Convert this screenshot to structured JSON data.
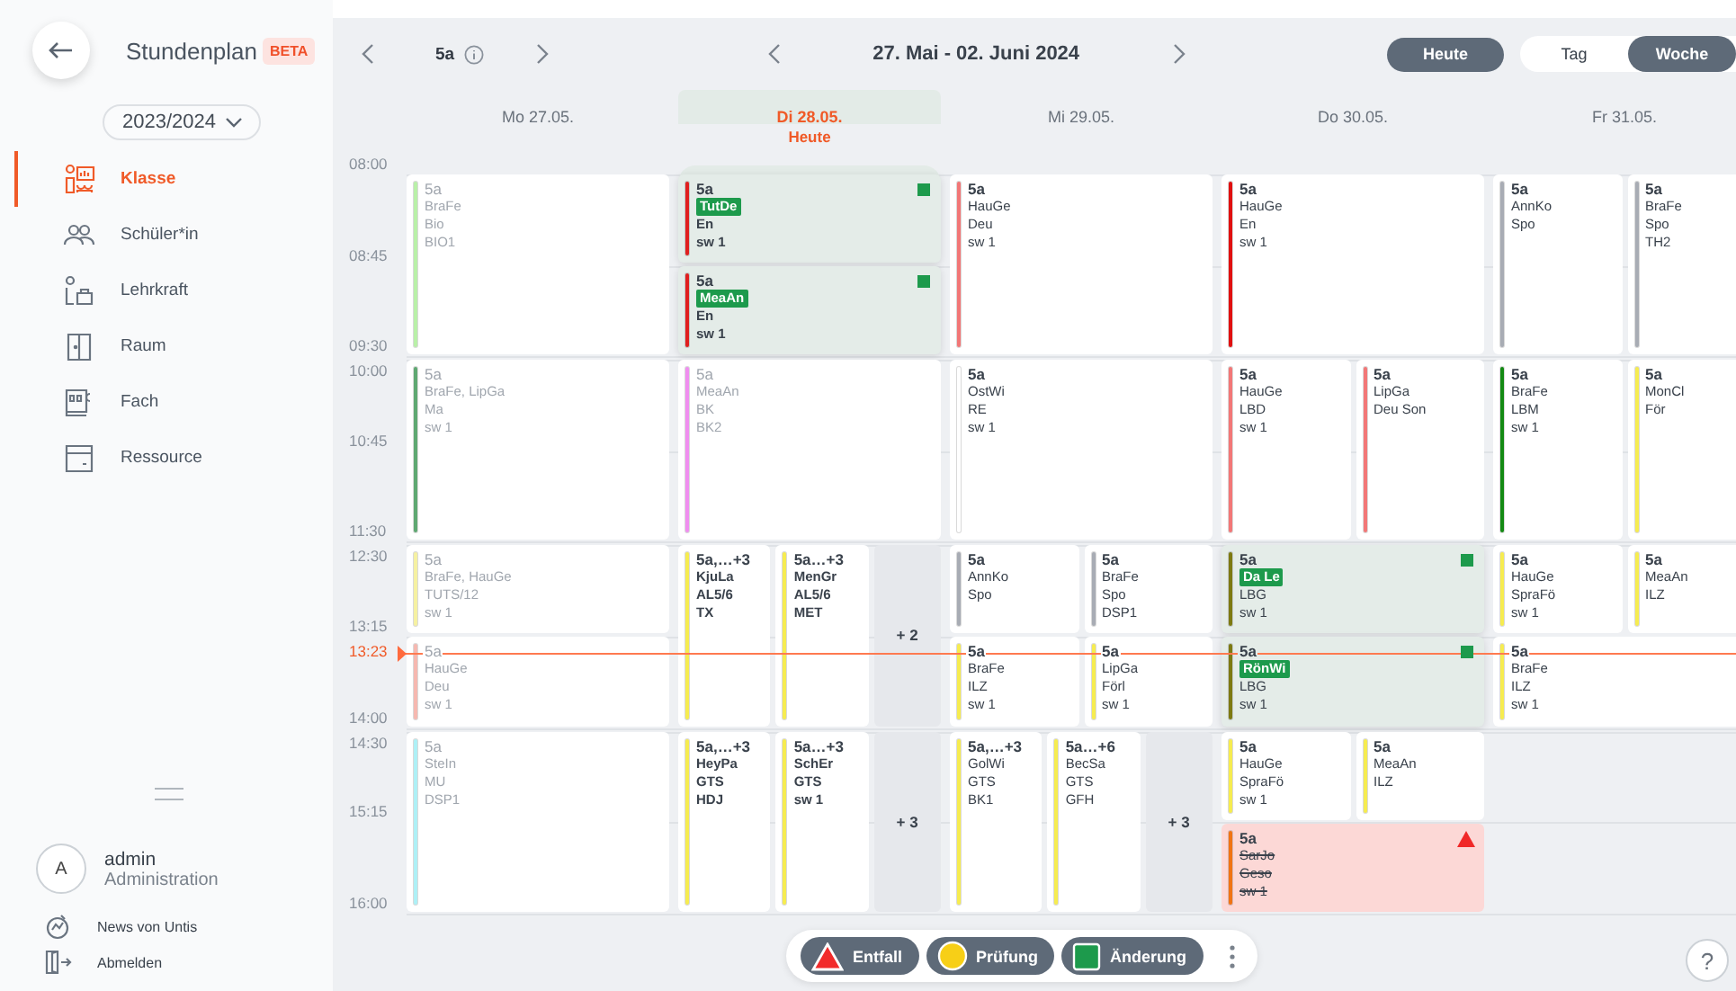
{
  "sidebar": {
    "title": "Stundenplan",
    "badge": "BETA",
    "year": "2023/2024",
    "items": [
      {
        "label": "Klasse",
        "selected": true
      },
      {
        "label": "Schüler*in",
        "selected": false
      },
      {
        "label": "Lehrkraft",
        "selected": false
      },
      {
        "label": "Raum",
        "selected": false
      },
      {
        "label": "Fach",
        "selected": false
      },
      {
        "label": "Ressource",
        "selected": false
      }
    ],
    "user": {
      "avatar": "A",
      "name": "admin",
      "role": "Administration"
    },
    "links": [
      {
        "label": "News von Untis"
      },
      {
        "label": "Abmelden"
      }
    ]
  },
  "toolbar": {
    "class_label": "5a",
    "week_label": "27. Mai - 02. Juni 2024",
    "today_button": "Heute",
    "views": [
      {
        "label": "Tag",
        "selected": false
      },
      {
        "label": "Woche",
        "selected": true
      }
    ]
  },
  "time_axis": [
    "08:00",
    "08:45",
    "09:30",
    "10:00",
    "10:45",
    "11:30",
    "12:30",
    "13:15",
    "14:00",
    "14:30",
    "15:15",
    "16:00"
  ],
  "now": {
    "label": "13:23"
  },
  "days": [
    {
      "label": "Mo 27.05.",
      "today": false,
      "periods": [
        {
          "rows": [
            {
              "lessons": [
                {
                  "title": "5a",
                  "lines": [
                    "BraFe",
                    "Bio",
                    "BIO1"
                  ],
                  "color": "#b9f0a8",
                  "kind": "normal",
                  "past": true
                }
              ]
            }
          ]
        },
        {
          "rows": [
            {
              "lessons": [
                {
                  "title": "5a",
                  "lines": [
                    "BraFe, LipGa",
                    "Ma",
                    "sw 1"
                  ],
                  "color": "#5fa872",
                  "kind": "normal",
                  "past": true
                }
              ]
            }
          ]
        },
        {
          "rows": [
            {
              "lessons": [
                {
                  "title": "5a",
                  "lines": [
                    "BraFe, HauGe",
                    "TUTS/12",
                    "sw 1"
                  ],
                  "color": "#f6f1a2",
                  "kind": "normal",
                  "past": true
                }
              ]
            },
            {
              "lessons": [
                {
                  "title": "5a",
                  "lines": [
                    "HauGe",
                    "Deu",
                    "sw 1"
                  ],
                  "color": "#f6b8b0",
                  "kind": "normal",
                  "past": true
                }
              ]
            }
          ]
        },
        {
          "rows": [
            {
              "lessons": [
                {
                  "title": "5a",
                  "lines": [
                    "SteIn",
                    "MU",
                    "DSP1"
                  ],
                  "color": "#aef0f6",
                  "kind": "normal",
                  "past": true
                }
              ]
            }
          ]
        }
      ]
    },
    {
      "label": "Di 28.05.",
      "today": true,
      "note": "Heute",
      "periods": [
        {
          "rows": [
            {
              "lessons": [
                {
                  "title": "5a",
                  "lines": [
                    "TutDe",
                    "En",
                    "sw 1"
                  ],
                  "color": "#e01f1f",
                  "kind": "changed",
                  "past": false
                }
              ]
            },
            {
              "lessons": [
                {
                  "title": "5a",
                  "lines": [
                    "MeaAn",
                    "En",
                    "sw 1"
                  ],
                  "color": "#e01f1f",
                  "kind": "changed",
                  "past": false
                }
              ]
            }
          ]
        },
        {
          "rows": [
            {
              "lessons": [
                {
                  "title": "5a",
                  "lines": [
                    "MeaAn",
                    "BK",
                    "BK2"
                  ],
                  "color": "#f08ef0",
                  "kind": "normal",
                  "past": true
                }
              ]
            }
          ]
        },
        {
          "rows": [
            {
              "more": "+ 2",
              "lessons": [
                {
                  "title": "5a,…+3",
                  "lines": [
                    "KjuLa",
                    "AL5/6",
                    "TX"
                  ],
                  "color": "#f6ec50",
                  "kind": "normal",
                  "past": false
                },
                {
                  "title": "5a…+3",
                  "lines": [
                    "MenGr",
                    "AL5/6",
                    "MET"
                  ],
                  "color": "#f6ec50",
                  "kind": "normal",
                  "past": false
                }
              ]
            }
          ]
        },
        {
          "rows": [
            {
              "more": "+ 3",
              "lessons": [
                {
                  "title": "5a,…+3",
                  "lines": [
                    "HeyPa",
                    "GTS",
                    "HDJ"
                  ],
                  "color": "#f6ec50",
                  "kind": "normal",
                  "past": false
                },
                {
                  "title": "5a…+3",
                  "lines": [
                    "SchEr",
                    "GTS",
                    "sw 1"
                  ],
                  "color": "#f6ec50",
                  "kind": "normal",
                  "past": false
                }
              ]
            }
          ]
        }
      ]
    },
    {
      "label": "Mi 29.05.",
      "today": false,
      "periods": [
        {
          "rows": [
            {
              "lessons": [
                {
                  "title": "5a",
                  "lines": [
                    "HauGe",
                    "Deu",
                    "sw 1"
                  ],
                  "color": "#f27777",
                  "kind": "normal",
                  "past": false
                }
              ]
            }
          ]
        },
        {
          "rows": [
            {
              "lessons": [
                {
                  "title": "5a",
                  "lines": [
                    "OstWi",
                    "RE",
                    "sw 1"
                  ],
                  "color": "#ffffff",
                  "kind": "normal",
                  "past": false
                }
              ]
            }
          ]
        },
        {
          "rows": [
            {
              "lessons": [
                {
                  "title": "5a",
                  "lines": [
                    "AnnKo",
                    "Spo"
                  ],
                  "color": "#a8acb4",
                  "kind": "normal",
                  "past": false
                },
                {
                  "title": "5a",
                  "lines": [
                    "BraFe",
                    "Spo",
                    "DSP1"
                  ],
                  "color": "#a8acb4",
                  "kind": "normal",
                  "past": false
                }
              ]
            },
            {
              "lessons": [
                {
                  "title": "5a",
                  "lines": [
                    "BraFe",
                    "ILZ",
                    "sw 1"
                  ],
                  "color": "#f6ec50",
                  "kind": "normal",
                  "past": false
                },
                {
                  "title": "5a",
                  "lines": [
                    "LipGa",
                    "Förl",
                    "sw 1"
                  ],
                  "color": "#f6ec50",
                  "kind": "normal",
                  "past": false
                }
              ]
            }
          ]
        },
        {
          "rows": [
            {
              "more": "+ 3",
              "lessons": [
                {
                  "title": "5a,…+3",
                  "lines": [
                    "GolWi",
                    "GTS",
                    "BK1"
                  ],
                  "color": "#f6ec50",
                  "kind": "normal",
                  "past": false
                },
                {
                  "title": "5a…+6",
                  "lines": [
                    "BecSa",
                    "GTS",
                    "GFH"
                  ],
                  "color": "#f6ec50",
                  "kind": "normal",
                  "past": false
                }
              ]
            }
          ]
        }
      ]
    },
    {
      "label": "Do 30.05.",
      "today": false,
      "periods": [
        {
          "rows": [
            {
              "lessons": [
                {
                  "title": "5a",
                  "lines": [
                    "HauGe",
                    "En",
                    "sw 1"
                  ],
                  "color": "#e01010",
                  "kind": "normal",
                  "past": false
                }
              ]
            }
          ]
        },
        {
          "rows": [
            {
              "lessons": [
                {
                  "title": "5a",
                  "lines": [
                    "HauGe",
                    "LBD",
                    "sw 1"
                  ],
                  "color": "#f27777",
                  "kind": "normal",
                  "past": false
                },
                {
                  "title": "5a",
                  "lines": [
                    "LipGa",
                    "Deu Son"
                  ],
                  "color": "#f27777",
                  "kind": "normal",
                  "past": false
                }
              ]
            }
          ]
        },
        {
          "rows": [
            {
              "lessons": [
                {
                  "title": "5a",
                  "lines": [
                    "Da Le",
                    "LBG",
                    "sw 1"
                  ],
                  "color": "#7d7a12",
                  "kind": "changed",
                  "past": false
                }
              ]
            },
            {
              "lessons": [
                {
                  "title": "5a",
                  "lines": [
                    "RönWi",
                    "LBG",
                    "sw 1"
                  ],
                  "color": "#7d7a12",
                  "kind": "changed",
                  "past": false
                }
              ]
            }
          ]
        },
        {
          "rows": [
            {
              "lessons": [
                {
                  "title": "5a",
                  "lines": [
                    "HauGe",
                    "SpraFö",
                    "sw 1"
                  ],
                  "color": "#f6ec50",
                  "kind": "normal",
                  "past": false
                },
                {
                  "title": "5a",
                  "lines": [
                    "MeaAn",
                    "ILZ"
                  ],
                  "color": "#f6ec50",
                  "kind": "normal",
                  "past": false
                }
              ]
            },
            {
              "lessons": [
                {
                  "title": "5a",
                  "lines": [
                    "SarJo",
                    "Geso",
                    "sw 1"
                  ],
                  "color": "#f07414",
                  "kind": "cancelled",
                  "past": false
                }
              ]
            }
          ]
        }
      ]
    },
    {
      "label": "Fr 31.05.",
      "today": false,
      "periods": [
        {
          "rows": [
            {
              "lessons": [
                {
                  "title": "5a",
                  "lines": [
                    "AnnKo",
                    "Spo"
                  ],
                  "color": "#a8acb4",
                  "kind": "normal",
                  "past": false
                },
                {
                  "title": "5a",
                  "lines": [
                    "BraFe",
                    "Spo",
                    "TH2"
                  ],
                  "color": "#a8acb4",
                  "kind": "normal",
                  "past": false
                }
              ]
            }
          ]
        },
        {
          "rows": [
            {
              "lessons": [
                {
                  "title": "5a",
                  "lines": [
                    "BraFe",
                    "LBM",
                    "sw 1"
                  ],
                  "color": "#138a13",
                  "kind": "normal",
                  "past": false
                },
                {
                  "title": "5a",
                  "lines": [
                    "MonCl",
                    "För"
                  ],
                  "color": "#f6ec50",
                  "kind": "normal",
                  "past": false
                }
              ]
            }
          ]
        },
        {
          "rows": [
            {
              "lessons": [
                {
                  "title": "5a",
                  "lines": [
                    "HauGe",
                    "SpraFö",
                    "sw 1"
                  ],
                  "color": "#f6ec50",
                  "kind": "normal",
                  "past": false
                },
                {
                  "title": "5a",
                  "lines": [
                    "MeaAn",
                    "ILZ"
                  ],
                  "color": "#f6ec50",
                  "kind": "normal",
                  "past": false
                }
              ]
            },
            {
              "lessons": [
                {
                  "title": "5a",
                  "lines": [
                    "BraFe",
                    "ILZ",
                    "sw 1"
                  ],
                  "color": "#f6ec50",
                  "kind": "normal",
                  "past": false
                }
              ]
            }
          ]
        }
      ]
    }
  ],
  "legend": [
    {
      "label": "Entfall",
      "kind": "cancelled"
    },
    {
      "label": "Prüfung",
      "kind": "exam"
    },
    {
      "label": "Änderung",
      "kind": "change"
    }
  ],
  "help": "?"
}
